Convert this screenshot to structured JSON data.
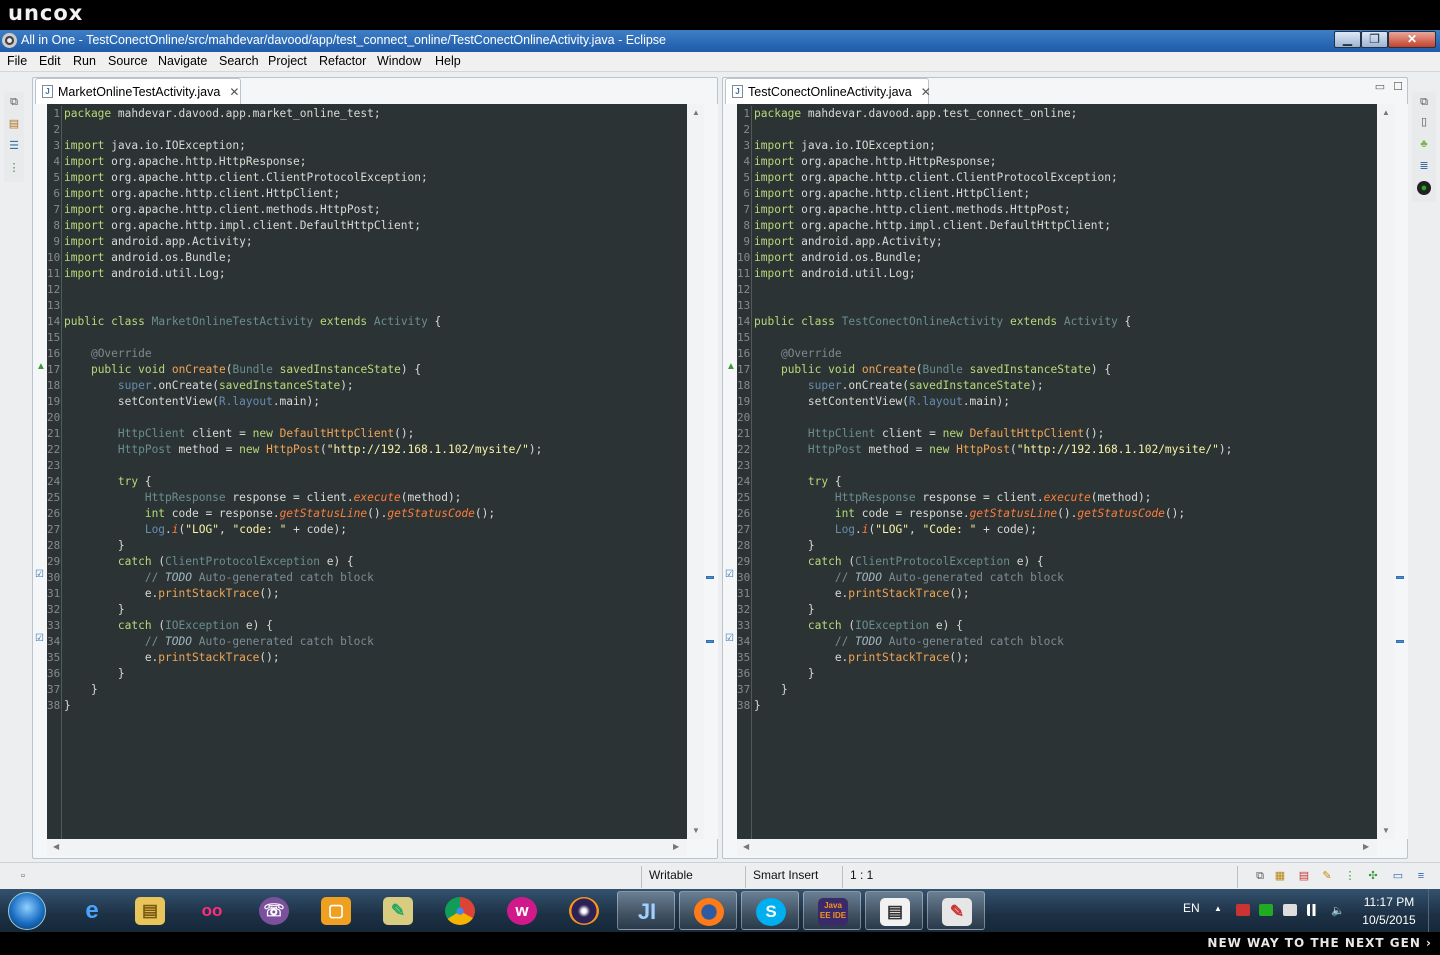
{
  "brand": {
    "logo": "uncox",
    "tagline": "NEW WAY TO THE NEXT GEN ›"
  },
  "window": {
    "title": "All in One - TestConectOnline/src/mahdevar/davood/app/test_connect_online/TestConectOnlineActivity.java - Eclipse",
    "minimize": "▁",
    "maximize": "❐",
    "close": "✕"
  },
  "menu": [
    "File",
    "Edit",
    "Run",
    "Source",
    "Navigate",
    "Search",
    "Project",
    "Refactor",
    "Window",
    "Help"
  ],
  "icons": {
    "app": "eclipse-icon",
    "file": "java-file-icon",
    "override": "override-triangle-icon",
    "task": "task-marker-icon"
  },
  "colors": {
    "editor_bg": "#2b3335",
    "keyword": "#b8d977",
    "type": "#6b8e8f",
    "method": "#f2a554",
    "string": "#f9f4a7",
    "comment": "#7d8c93"
  },
  "editors": [
    {
      "tab_label": "MarketOnlineTestActivity.java",
      "package": "mahdevar.davood.app.market_online_test",
      "class_name": "MarketOnlineTestActivity",
      "log_tag": "\"LOG\"",
      "log_msg": "\"code: \"",
      "url": "\"http://192.168.1.102/mysite/\""
    },
    {
      "tab_label": "TestConectOnlineActivity.java",
      "package": "mahdevar.davood.app.test_connect_online",
      "class_name": "TestConectOnlineActivity",
      "log_tag": "\"LOG\"",
      "log_msg": "\"Code: \"",
      "url": "\"http://192.168.1.102/mysite/\""
    }
  ],
  "line_numbers": [
    "1",
    "2",
    "3",
    "4",
    "5",
    "6",
    "7",
    "8",
    "9",
    "10",
    "11",
    "12",
    "13",
    "14",
    "15",
    "16",
    "17",
    "18",
    "19",
    "20",
    "21",
    "22",
    "23",
    "24",
    "25",
    "26",
    "27",
    "28",
    "29",
    "30",
    "31",
    "32",
    "33",
    "34",
    "35",
    "36",
    "37",
    "38"
  ],
  "code": {
    "package_kw": "package",
    "import_kw": "import",
    "imports": [
      "java.io.IOException;",
      "org.apache.http.HttpResponse;",
      "org.apache.http.client.ClientProtocolException;",
      "org.apache.http.client.HttpClient;",
      "org.apache.http.client.methods.HttpPost;",
      "org.apache.http.impl.client.DefaultHttpClient;",
      "android.app.Activity;",
      "android.os.Bundle;",
      "android.util.Log;"
    ],
    "public_kw": "public",
    "class_kw": "class",
    "extends_kw": "extends",
    "activity": "Activity",
    "override": "@Override",
    "void_kw": "void",
    "oncreate": "onCreate",
    "bundle": "Bundle",
    "saved": "savedInstanceState",
    "super_kw": "super",
    "setcontentview": "setContentView",
    "r_layout": "R.layout",
    "main": ".main);",
    "httpclient": "HttpClient",
    "client": "client",
    "new_kw": "new",
    "defaulthttpclient": "DefaultHttpClient",
    "httppost": "HttpPost",
    "method_var": "method",
    "try_kw": "try",
    "httpresponse": "HttpResponse",
    "response": "response",
    "execute": "execute",
    "int_kw": "int",
    "code_var": "code",
    "getstatusline": "getStatusLine",
    "getstatuscode": "getStatusCode",
    "log": "Log",
    "log_i": "i",
    "catch_kw": "catch",
    "cpe": "ClientProtocolException",
    "ioe": "IOException",
    "todo_kw": "TODO",
    "todo_text": " Auto-generated catch block",
    "printstacktrace": "printStackTrace"
  },
  "status": {
    "writable": "Writable",
    "insert_mode": "Smart Insert",
    "position": "1 : 1"
  },
  "taskbar": {
    "apps": [
      "windows-start",
      "internet-explorer",
      "file-explorer",
      "flickr",
      "viber",
      "sticky-notes",
      "paint-brush",
      "chrome",
      "wamp",
      "eclipse",
      "jetbrains",
      "firefox",
      "skype",
      "java-ee-ide",
      "notepad",
      "paint"
    ],
    "java_ee_label": "Java EE IDE",
    "lang": "EN",
    "time": "11:17 PM",
    "date": "10/5/2015"
  }
}
